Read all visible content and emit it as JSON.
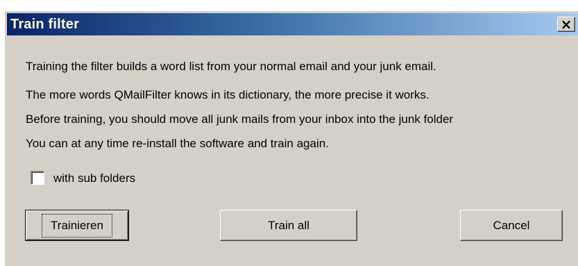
{
  "dialog": {
    "title": "Train filter",
    "close_glyph": "×",
    "close_icon": "close-icon"
  },
  "body": {
    "lines": [
      "Training the filter builds a word list from your normal email and your junk email.",
      "The more words QMailFilter knows in its dictionary, the more precise it works.",
      "Before training, you should move all junk mails from your inbox into the junk folder",
      "You can at any time re-install the software and train again."
    ]
  },
  "options": {
    "subfolders_label": "with sub folders",
    "subfolders_checked": false
  },
  "buttons": {
    "train": "Trainieren",
    "train_all": "Train all",
    "cancel": "Cancel"
  },
  "colors": {
    "titlebar_start": "#0a246a",
    "titlebar_end": "#a6caf0",
    "face": "#d4d0c8"
  }
}
